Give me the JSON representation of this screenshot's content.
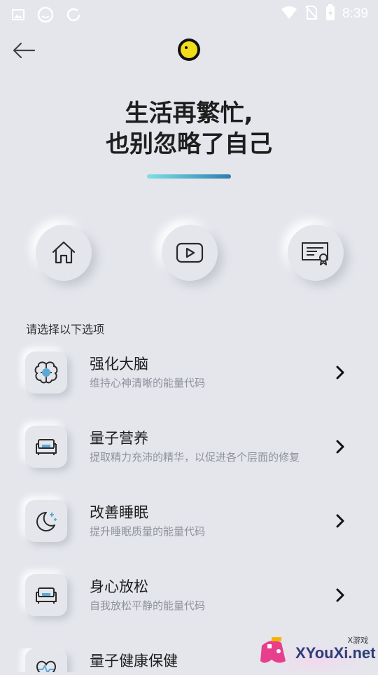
{
  "status_bar": {
    "time": "8:39",
    "icons": [
      "image-icon",
      "smiley-icon",
      "sync-icon",
      "wifi-icon",
      "no-sim-icon",
      "battery-charging-icon"
    ]
  },
  "top_bar": {
    "back_icon": "arrow-left-icon",
    "logo_icon": "yellow-circle-logo"
  },
  "headline": {
    "line1": "生活再繁忙,",
    "line2": "也别忽略了自己"
  },
  "circle_buttons": [
    "home-icon",
    "play-video-icon",
    "certificate-icon"
  ],
  "section_label": "请选择以下选项",
  "items": [
    {
      "title": "强化大脑",
      "desc": "维持心神清晰的能量代码",
      "icon": "brain-icon"
    },
    {
      "title": "量子营养",
      "desc": "提取精力充沛的精华，以促进各个层面的修复",
      "icon": "sofa-icon"
    },
    {
      "title": "改善睡眠",
      "desc": "提升睡眠质量的能量代码",
      "icon": "moon-stars-icon"
    },
    {
      "title": "身心放松",
      "desc": "自我放松平静的能量代码",
      "icon": "sofa-icon"
    },
    {
      "title": "量子健康保健",
      "desc": "",
      "icon": "heart-pulse-icon"
    }
  ],
  "watermark": {
    "text": "XYouXi.net",
    "small": "X游戏"
  },
  "colors": {
    "background": "#e4e6ec",
    "accent_gradient_start": "#7fe0e4",
    "accent_gradient_end": "#2d7db0",
    "icon_blue": "#5aa9d6"
  }
}
